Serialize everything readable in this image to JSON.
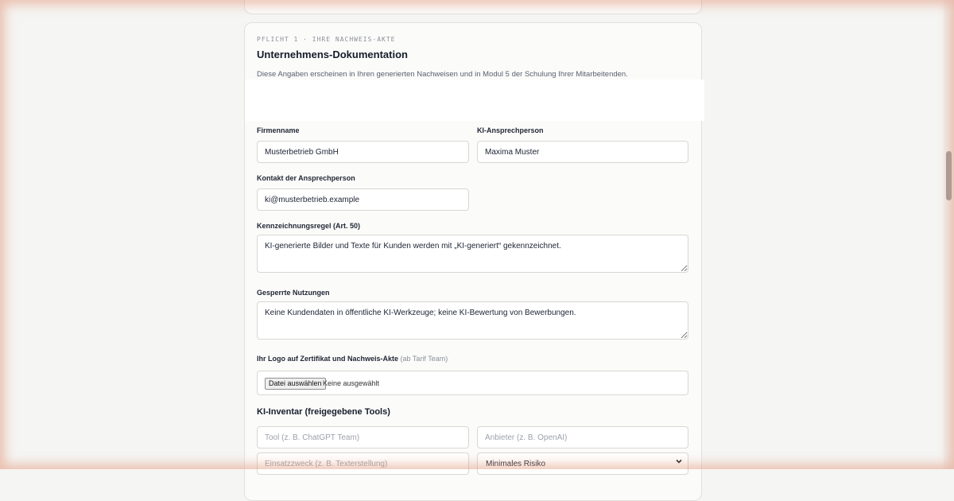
{
  "section": {
    "eyebrow": "PFLICHT 1 · IHRE NACHWEIS-AKTE",
    "title": "Unternehmens-Dokumentation",
    "subtitle": "Diese Angaben erscheinen in Ihren generierten Nachweisen und in Modul 5 der Schulung Ihrer Mitarbeitenden."
  },
  "fields": {
    "firmenname": {
      "label": "Firmenname",
      "value": "Musterbetrieb GmbH"
    },
    "ansprechperson": {
      "label": "KI-Ansprechperson",
      "value": "Maxima Muster"
    },
    "kontakt": {
      "label": "Kontakt der Ansprechperson",
      "value": "ki@musterbetrieb.example"
    },
    "kennzeichnung": {
      "label": "Kennzeichnungsregel (Art. 50)",
      "value": "KI-generierte Bilder und Texte für Kunden werden mit „KI-generiert“ gekennzeichnet."
    },
    "gesperrt": {
      "label": "Gesperrte Nutzungen",
      "value": "Keine Kundendaten in öffentliche KI-Werkzeuge; keine KI-Bewertung von Bewerbungen."
    },
    "logo": {
      "label": "Ihr Logo auf Zertifikat und Nachweis-Akte",
      "hint": "(ab Tarif Team)",
      "button": "Datei auswählen",
      "status": "Keine ausgewählt"
    }
  },
  "inventory": {
    "title": "KI-Inventar (freigegebene Tools)",
    "tool_placeholder": "Tool (z. B. ChatGPT Team)",
    "vendor_placeholder": "Anbieter (z. B. OpenAI)",
    "purpose_placeholder": "Einsatzzweck (z. B. Texterstellung)",
    "risk_selected": "Minimales Risiko"
  }
}
